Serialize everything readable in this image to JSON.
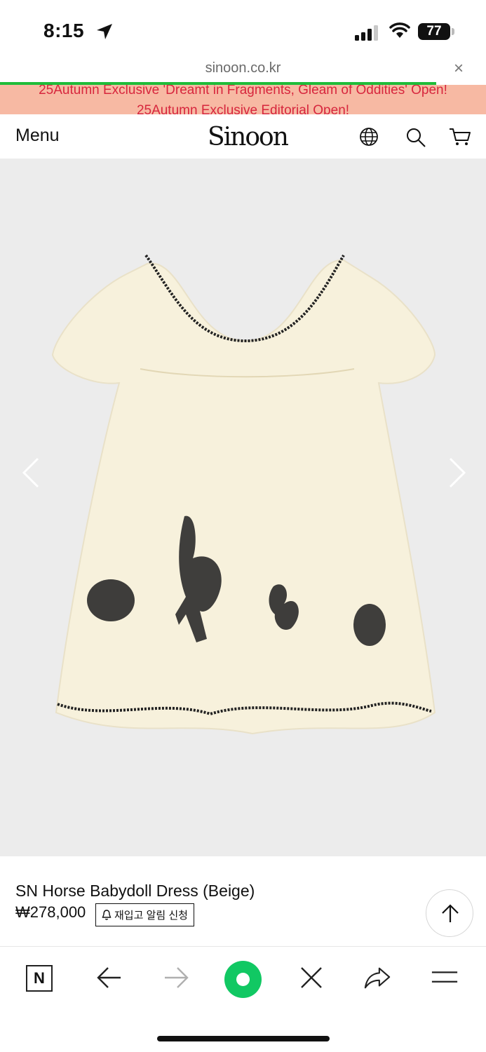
{
  "status_bar": {
    "time": "8:15",
    "battery": "77"
  },
  "browser": {
    "url": "sinoon.co.kr",
    "close_label": "×"
  },
  "announcement": {
    "line1": "25Autumn Exclusive 'Dreamt in Fragments, Gleam of Oddities' Open!",
    "line2": "25Autumn Exclusive Editorial Open!"
  },
  "header": {
    "menu_label": "Menu",
    "logo_text": "Sinoon"
  },
  "product": {
    "name": "SN Horse Babydoll Dress (Beige)",
    "price": "₩278,000",
    "restock_label": "재입고 알림 신청"
  },
  "toolbar": {
    "n_label": "N"
  },
  "colors": {
    "progress": "#1fbd3a",
    "announcement_bg": "#f7b9a3",
    "announcement_text": "#d7263d",
    "green_button": "#11c863",
    "image_bg": "#ececec"
  }
}
